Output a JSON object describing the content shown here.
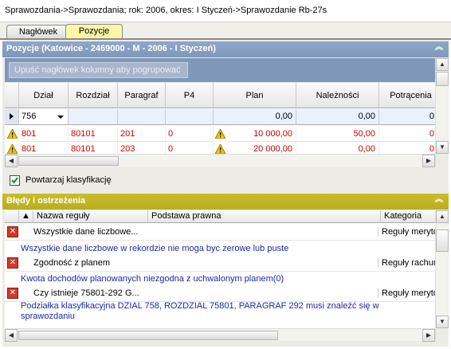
{
  "breadcrumb": "Sprawozdania->Sprawozdania; rok: 2006, okres: I Styczeń->Sprawozdanie Rb-27s",
  "tabs": [
    {
      "label": "Nagłówek",
      "active": false
    },
    {
      "label": "Pozycje",
      "active": true
    }
  ],
  "pozycje_panel": {
    "title": "Pozycje  (Katowice - 2469000 - M - 2006 - I Styczeń)",
    "group_placeholder": "Upuść nagłówek kolumny aby pogrupować",
    "columns": [
      "Dział",
      "Rozdział",
      "Paragraf",
      "P4",
      "Plan",
      "Należności",
      "Potrącenia"
    ],
    "filter_row": {
      "dzial": "756",
      "plan": "0,00",
      "naleznosci": "0,00",
      "potracenia": "0"
    },
    "rows": [
      {
        "dzial": "801",
        "rozdzial": "80101",
        "paragraf": "201",
        "p4": "0",
        "plan": "10 000,00",
        "naleznosci": "50,00",
        "potracenia": "0"
      },
      {
        "dzial": "801",
        "rozdzial": "80101",
        "paragraf": "203",
        "p4": "0",
        "plan": "20 000,00",
        "naleznosci": "0,00",
        "potracenia": "0"
      }
    ]
  },
  "checkbox": {
    "label": "Powtarzaj klasyfikację",
    "checked": true
  },
  "errors_panel": {
    "title": "Błędy i ostrzeżenia",
    "columns": [
      "Nazwa reguły",
      "Podstawa prawna",
      "Kategoria"
    ],
    "items": [
      {
        "name": "Wszystkie dane liczbowe...",
        "category": "Reguły meryto",
        "message": "Wszystkie dane liczbowe w rekordzie nie moga byc zerowe lub puste"
      },
      {
        "name": "Zgodność z planem",
        "category": "Reguły rachun",
        "message": "Kwota dochodów planowanych niezgodna z uchwalonym planem(0)"
      },
      {
        "name": "Czy istnieje 75801-292 G...",
        "category": "Reguły meryto",
        "message": "Podziałka klasyfikacyjna DZIAL 758, ROZDZIAL 75801, PARAGRAF 292 musi znaleźć się w sprawozdaniu"
      }
    ]
  },
  "colors": {
    "pozycje_header": "#7f97ba",
    "errors_header": "#b9ad21",
    "error_text": "#cc0000",
    "message_text": "#1a2aa8"
  }
}
